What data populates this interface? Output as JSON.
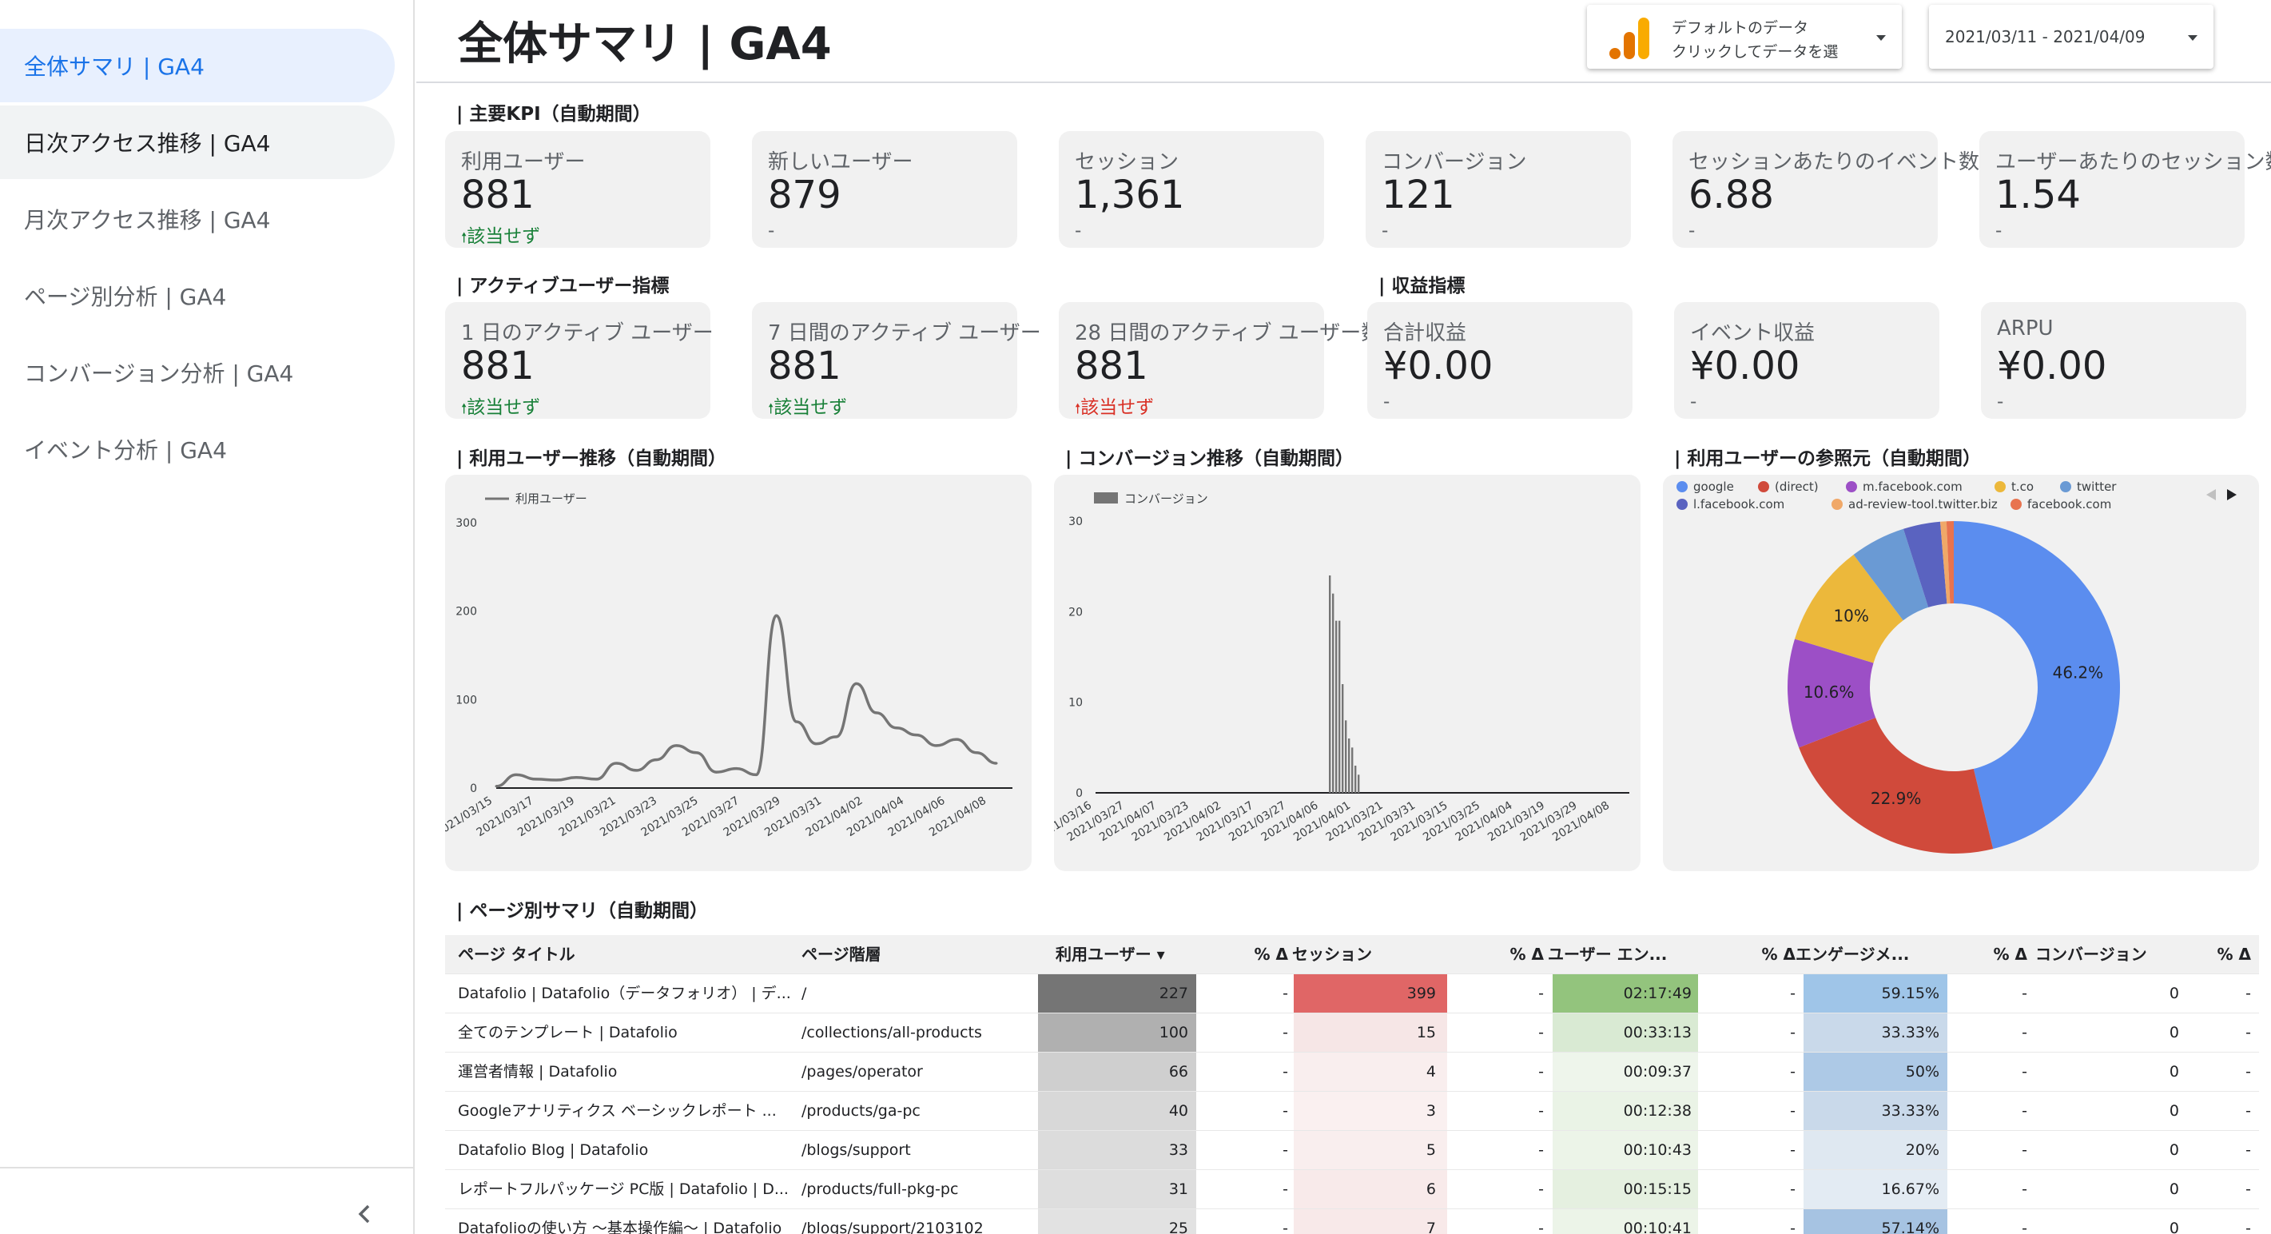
{
  "sidebar": {
    "items": [
      {
        "label": "全体サマリ | GA4"
      },
      {
        "label": "日次アクセス推移 | GA4"
      },
      {
        "label": "月次アクセス推移 | GA4"
      },
      {
        "label": "ページ別分析 | GA4"
      },
      {
        "label": "コンバージョン分析 | GA4"
      },
      {
        "label": "イベント分析 | GA4"
      }
    ],
    "collapse_icon": "chevron-left-icon"
  },
  "header": {
    "title": "全体サマリ | GA4",
    "data_source": {
      "line1": "デフォルトのデータ",
      "line2": "クリックしてデータを選",
      "icon": "google-analytics-icon"
    },
    "date_range": "2021/03/11 - 2021/04/09"
  },
  "sections": {
    "kpi": "| 主要KPI（自動期間）",
    "active": "| アクティブユーザー指標",
    "revenue": "| 収益指標",
    "users_trend": "| 利用ユーザー推移（自動期間）",
    "conv_trend": "| コンバージョン推移（自動期間）",
    "referrer": "| 利用ユーザーの参照元（自動期間）",
    "page_summary": "| ページ別サマリ（自動期間）"
  },
  "kpi_cards": [
    {
      "label": "利用ユーザー",
      "value": "881",
      "delta": "該当せず",
      "delta_type": "up"
    },
    {
      "label": "新しいユーザー",
      "value": "879",
      "delta": "-",
      "delta_type": "none"
    },
    {
      "label": "セッション",
      "value": "1,361",
      "delta": "-",
      "delta_type": "none"
    },
    {
      "label": "コンバージョン",
      "value": "121",
      "delta": "-",
      "delta_type": "none"
    },
    {
      "label": "セッションあたりのイベント数",
      "value": "6.88",
      "delta": "-",
      "delta_type": "none"
    },
    {
      "label": "ユーザーあたりのセッション数",
      "value": "1.54",
      "delta": "-",
      "delta_type": "none"
    }
  ],
  "active_cards": [
    {
      "label": "1 日のアクティブ ユーザー",
      "value": "881",
      "delta": "該当せず",
      "delta_type": "up"
    },
    {
      "label": "7 日間のアクティブ ユーザー",
      "value": "881",
      "delta": "該当せず",
      "delta_type": "up"
    },
    {
      "label": "28 日間のアクティブ ユーザー数",
      "value": "881",
      "delta": "該当せず",
      "delta_type": "red"
    }
  ],
  "revenue_cards": [
    {
      "label": "合計収益",
      "value": "¥0.00",
      "delta": "-",
      "delta_type": "none"
    },
    {
      "label": "イベント収益",
      "value": "¥0.00",
      "delta": "-",
      "delta_type": "none"
    },
    {
      "label": "ARPU",
      "value": "¥0.00",
      "delta": "-",
      "delta_type": "none"
    }
  ],
  "chart_data": [
    {
      "type": "line",
      "series": [
        {
          "name": "利用ユーザー",
          "values": [
            2,
            15,
            10,
            9,
            12,
            10,
            28,
            20,
            32,
            48,
            40,
            18,
            22,
            15,
            195,
            75,
            50,
            58,
            118,
            85,
            68,
            60,
            48,
            55,
            40,
            28
          ]
        }
      ],
      "x_ticks": [
        "2021/03/15",
        "2021/03/17",
        "2021/03/19",
        "2021/03/21",
        "2021/03/23",
        "2021/03/25",
        "2021/03/27",
        "2021/03/29",
        "2021/03/31",
        "2021/04/02",
        "2021/04/04",
        "2021/04/06",
        "2021/04/08"
      ],
      "y_ticks": [
        "0",
        "100",
        "200",
        "300"
      ],
      "ylim": [
        0,
        300
      ],
      "color": "#757575"
    },
    {
      "type": "bar",
      "series": [
        {
          "name": "コンバージョン",
          "values": [
            24,
            22,
            19,
            19,
            12,
            8,
            6,
            5,
            3,
            2
          ]
        }
      ],
      "x_ticks": [
        "21/03/16",
        "2021/03/27",
        "2021/04/07",
        "2021/03/23",
        "2021/04/02",
        "2021/03/17",
        "2021/03/27",
        "2021/04/06",
        "2021/04/01",
        "2021/03/21",
        "2021/03/31",
        "2021/03/15",
        "2021/03/25",
        "2021/04/04",
        "2021/03/19",
        "2021/03/29",
        "2021/04/08"
      ],
      "y_ticks": [
        "0",
        "10",
        "20",
        "30"
      ],
      "ylim": [
        0,
        30
      ],
      "color": "#757575"
    },
    {
      "type": "pie",
      "legend": [
        {
          "name": "google",
          "color": "#5b8def"
        },
        {
          "name": "(direct)",
          "color": "#d04a3b"
        },
        {
          "name": "m.facebook.com",
          "color": "#9c4fc6"
        },
        {
          "name": "t.co",
          "color": "#ecb83b"
        },
        {
          "name": "twitter",
          "color": "#6a9ad4"
        },
        {
          "name": "l.facebook.com",
          "color": "#5a63c0"
        },
        {
          "name": "ad-review-tool.twitter.biz",
          "color": "#f0a868"
        },
        {
          "name": "facebook.com",
          "color": "#e8734f"
        }
      ],
      "values": [
        46.2,
        22.9,
        10.6,
        10.0,
        5.4,
        3.6,
        0.6,
        0.7
      ],
      "labels": [
        "46.2%",
        "22.9%",
        "10.6%",
        "10%"
      ]
    }
  ],
  "table": {
    "headers": [
      "ページ タイトル",
      "ページ階層",
      "利用ユーザー ▾",
      "% Δ",
      "セッション",
      "% Δ",
      "ユーザー エン...",
      "% Δ",
      "エンゲージメ...",
      "% Δ",
      "コンバージョン",
      "% Δ"
    ],
    "rows": [
      [
        "Datafolio | Datafolio（データフォリオ） | デ...",
        "/",
        "227",
        "-",
        "399",
        "-",
        "02:17:49",
        "-",
        "59.15%",
        "-",
        "0",
        "-"
      ],
      [
        "全てのテンプレート | Datafolio",
        "/collections/all-products",
        "100",
        "-",
        "15",
        "-",
        "00:33:13",
        "-",
        "33.33%",
        "-",
        "0",
        "-"
      ],
      [
        "運営者情報 | Datafolio",
        "/pages/operator",
        "66",
        "-",
        "4",
        "-",
        "00:09:37",
        "-",
        "50%",
        "-",
        "0",
        "-"
      ],
      [
        "Googleアナリティクス ベーシックレポート ...",
        "/products/ga-pc",
        "40",
        "-",
        "3",
        "-",
        "00:12:38",
        "-",
        "33.33%",
        "-",
        "0",
        "-"
      ],
      [
        "Datafolio Blog | Datafolio",
        "/blogs/support",
        "33",
        "-",
        "5",
        "-",
        "00:10:43",
        "-",
        "20%",
        "-",
        "0",
        "-"
      ],
      [
        "レポートフルパッケージ PC版 | Datafolio | D...",
        "/products/full-pkg-pc",
        "31",
        "-",
        "6",
        "-",
        "00:15:15",
        "-",
        "16.67%",
        "-",
        "0",
        "-"
      ],
      [
        "Datafolioの使い方 〜基本操作編〜 | Datafolio",
        "/blogs/support/2103102",
        "25",
        "-",
        "7",
        "-",
        "00:10:41",
        "-",
        "57.14%",
        "-",
        "0",
        "-"
      ]
    ],
    "heat": {
      "users": [
        "#757575",
        "#b0b0b0",
        "#cfcfcf",
        "#d8d8d8",
        "#dcdcdc",
        "#dedede",
        "#e2e2e2"
      ],
      "sessions": [
        "#e06666",
        "#f6e6e6",
        "#f9eeee",
        "#faf0f0",
        "#f9eeee",
        "#f8eaea",
        "#f8e9e9"
      ],
      "engage_time": [
        "#93c47d",
        "#d9ead3",
        "#eef5eb",
        "#eaf3e6",
        "#ecf4e8",
        "#e5f0e0",
        "#ecf4e8"
      ],
      "engage_rate": [
        "#9fc5e8",
        "#c9d9ea",
        "#adc9e6",
        "#c9d9ea",
        "#dfe8f1",
        "#e3ebf3",
        "#a6c3e2"
      ]
    }
  }
}
